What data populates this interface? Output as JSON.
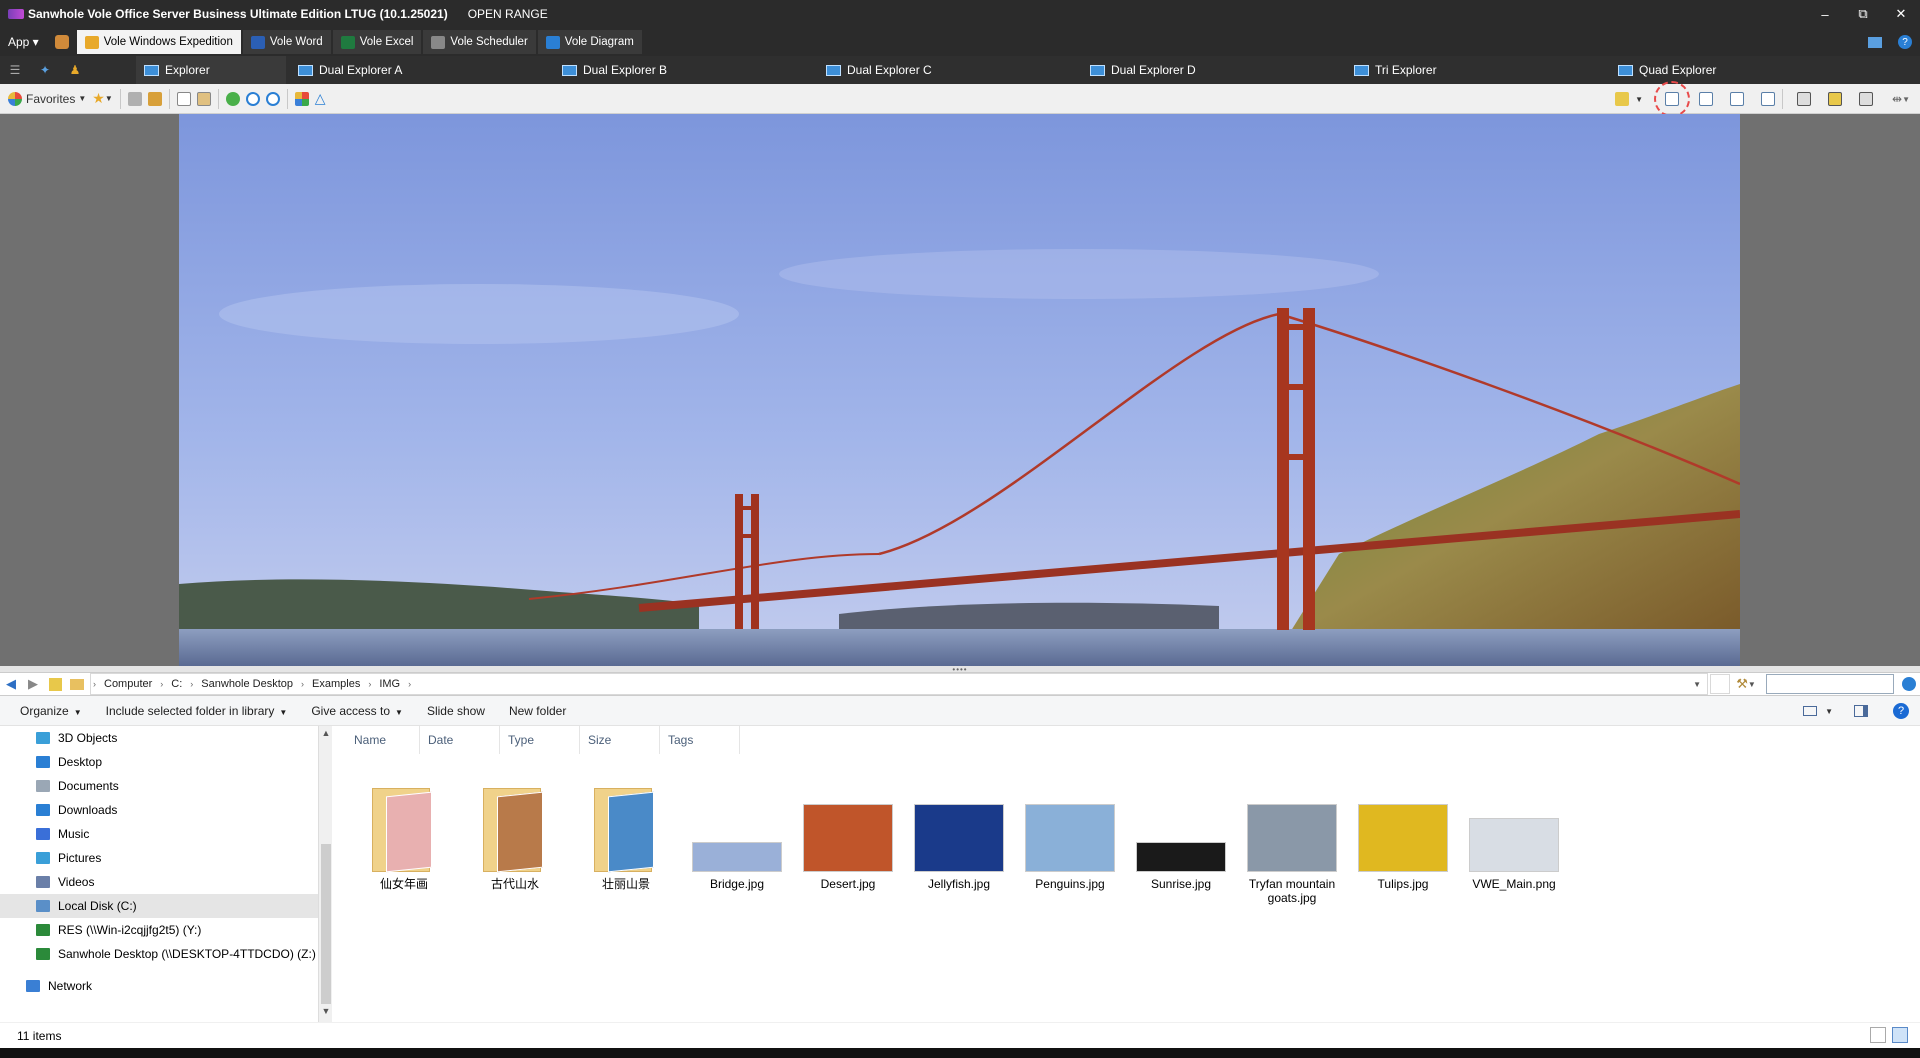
{
  "window": {
    "title": "Sanwhole Vole Office Server Business Ultimate Edition LTUG (10.1.25021)",
    "range_label": "OPEN RANGE",
    "minimize": "–",
    "restore": "⧉",
    "close": "✕"
  },
  "menubar": {
    "app_label": "App ▾",
    "apps": [
      {
        "label": "Vole Windows Expedition",
        "color": "#e8a92a"
      },
      {
        "label": "Vole Word",
        "color": "#2b5fb4"
      },
      {
        "label": "Vole Excel",
        "color": "#1f7a3f"
      },
      {
        "label": "Vole Scheduler",
        "color": "#888888"
      },
      {
        "label": "Vole Diagram",
        "color": "#2a7fd4"
      }
    ]
  },
  "explorer_tabs": [
    {
      "label": "Explorer"
    },
    {
      "label": "Dual Explorer A"
    },
    {
      "label": "Dual Explorer B"
    },
    {
      "label": "Dual Explorer C"
    },
    {
      "label": "Dual Explorer D"
    },
    {
      "label": "Tri Explorer"
    },
    {
      "label": "Quad Explorer"
    }
  ],
  "toolbar": {
    "favorites_label": "Favorites"
  },
  "address": {
    "crumbs": [
      "Computer",
      "C:",
      "Sanwhole Desktop",
      "Examples",
      "IMG"
    ]
  },
  "commands": {
    "organize": "Organize",
    "include": "Include selected folder in library",
    "share": "Give access to",
    "slideshow": "Slide show",
    "new_folder": "New folder"
  },
  "tree": {
    "items": [
      {
        "label": "3D Objects",
        "color": "#3a9fd8"
      },
      {
        "label": "Desktop",
        "color": "#2a7fd4"
      },
      {
        "label": "Documents",
        "color": "#9aa7b5"
      },
      {
        "label": "Downloads",
        "color": "#2a7fd4"
      },
      {
        "label": "Music",
        "color": "#3a6fd8"
      },
      {
        "label": "Pictures",
        "color": "#3a9fd8"
      },
      {
        "label": "Videos",
        "color": "#6a7fa8"
      },
      {
        "label": "Local Disk (C:)",
        "color": "#5a8fc8"
      },
      {
        "label": "RES (\\\\Win-i2cqjjfg2t5) (Y:)",
        "color": "#2b8a3a"
      },
      {
        "label": "Sanwhole Desktop (\\\\DESKTOP-4TTDCDO) (Z:)",
        "color": "#2b8a3a"
      },
      {
        "label": "Network",
        "color": "#3a7fd4"
      }
    ]
  },
  "columns": [
    "Name",
    "Date",
    "Type",
    "Size",
    "Tags"
  ],
  "files": [
    {
      "name": "仙女年画",
      "kind": "folder",
      "art": "#e8b0b0"
    },
    {
      "name": "古代山水",
      "kind": "folder",
      "art": "#b87a4a"
    },
    {
      "name": "壮丽山景",
      "kind": "folder",
      "art": "#4a8ac8"
    },
    {
      "name": "Bridge.jpg",
      "kind": "image",
      "art": "#9ab0d8"
    },
    {
      "name": "Desert.jpg",
      "kind": "image",
      "art": "#c0552a"
    },
    {
      "name": "Jellyfish.jpg",
      "kind": "image",
      "art": "#1a3a8a"
    },
    {
      "name": "Penguins.jpg",
      "kind": "image",
      "art": "#8ab0d8"
    },
    {
      "name": "Sunrise.jpg",
      "kind": "image",
      "art": "#1a1a1a"
    },
    {
      "name": "Tryfan mountain goats.jpg",
      "kind": "image",
      "art": "#8a98a8"
    },
    {
      "name": "Tulips.jpg",
      "kind": "image",
      "art": "#e0b820"
    },
    {
      "name": "VWE_Main.png",
      "kind": "image",
      "art": "#d8dde4"
    }
  ],
  "status": {
    "count": "11 items"
  }
}
